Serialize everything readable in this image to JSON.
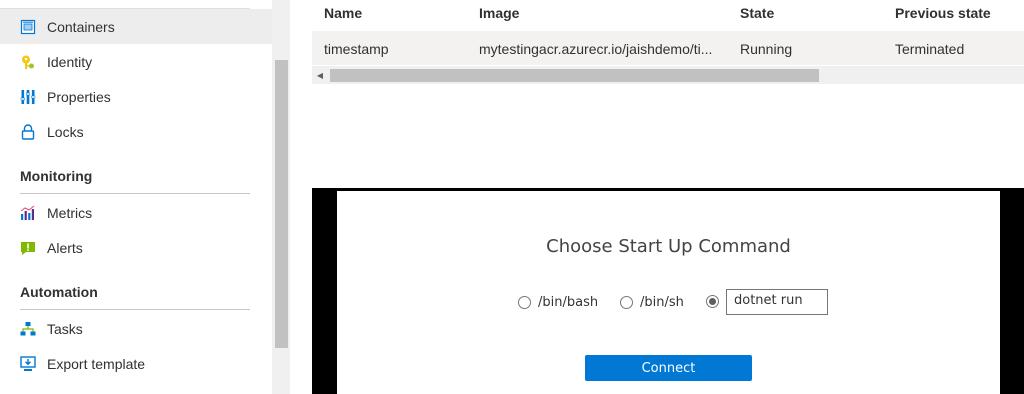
{
  "sidebar": {
    "items": [
      {
        "label": "Containers",
        "icon": "containers-icon",
        "selected": true
      },
      {
        "label": "Identity",
        "icon": "identity-key-icon"
      },
      {
        "label": "Properties",
        "icon": "properties-icon"
      },
      {
        "label": "Locks",
        "icon": "lock-icon"
      }
    ],
    "monitoring": {
      "title": "Monitoring",
      "items": [
        {
          "label": "Metrics",
          "icon": "metrics-chart-icon"
        },
        {
          "label": "Alerts",
          "icon": "alert-icon"
        }
      ]
    },
    "automation": {
      "title": "Automation",
      "items": [
        {
          "label": "Tasks",
          "icon": "tasks-icon"
        },
        {
          "label": "Export template",
          "icon": "export-template-icon"
        }
      ]
    }
  },
  "table": {
    "headers": [
      "Name",
      "Image",
      "State",
      "Previous state"
    ],
    "rows": [
      [
        "timestamp",
        "mytestingacr.azurecr.io/jaishdemo/ti...",
        "Running",
        "Terminated"
      ]
    ]
  },
  "console": {
    "title": "Choose Start Up Command",
    "options": [
      "/bin/bash",
      "/bin/sh"
    ],
    "selected": "custom",
    "custom_value": "dotnet run",
    "connect_label": "Connect"
  },
  "colors": {
    "accent": "#0078d4",
    "selected_bg": "#ededed",
    "row_bg": "#f3f2f1"
  }
}
